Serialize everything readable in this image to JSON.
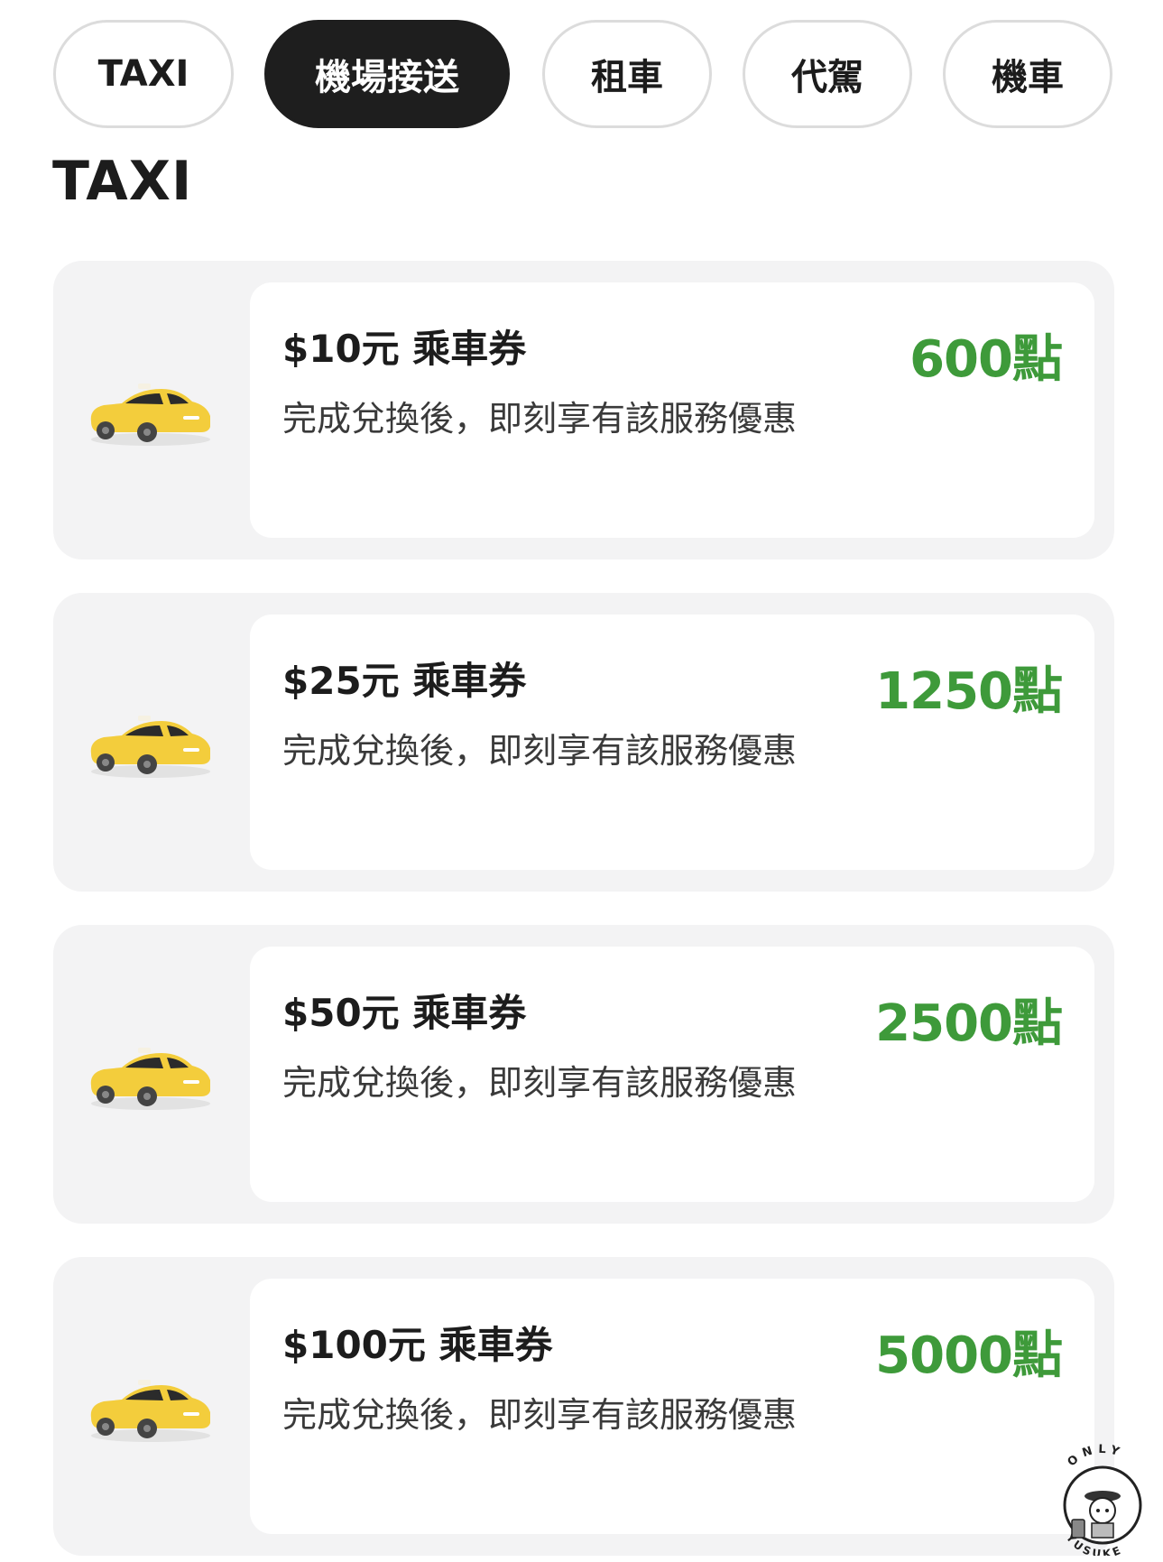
{
  "tabs": [
    {
      "label": "TAXI",
      "active": false
    },
    {
      "label": "機場接送",
      "active": true
    },
    {
      "label": "租車",
      "active": false
    },
    {
      "label": "代駕",
      "active": false
    },
    {
      "label": "機車",
      "active": false
    }
  ],
  "section_title": "TAXI",
  "vouchers": [
    {
      "title": "$10元 乘車券",
      "description": "完成兌換後，即刻享有該服務優惠",
      "points": "600點",
      "icon": "taxi-car-icon"
    },
    {
      "title": "$25元 乘車券",
      "description": "完成兌換後，即刻享有該服務優惠",
      "points": "1250點",
      "icon": "taxi-car-icon"
    },
    {
      "title": "$50元 乘車券",
      "description": "完成兌換後，即刻享有該服務優惠",
      "points": "2500點",
      "icon": "taxi-car-icon"
    },
    {
      "title": "$100元 乘車券",
      "description": "完成兌換後，即刻享有該服務優惠",
      "points": "5000點",
      "icon": "taxi-car-icon"
    }
  ],
  "watermark": {
    "top_text": "ONLY",
    "bottom_text": "YUSUKE"
  },
  "colors": {
    "accent_green": "#3e9a3a",
    "active_tab_bg": "#1e1e1e",
    "card_bg": "#f3f3f4",
    "car_yellow": "#f3cd3c"
  }
}
